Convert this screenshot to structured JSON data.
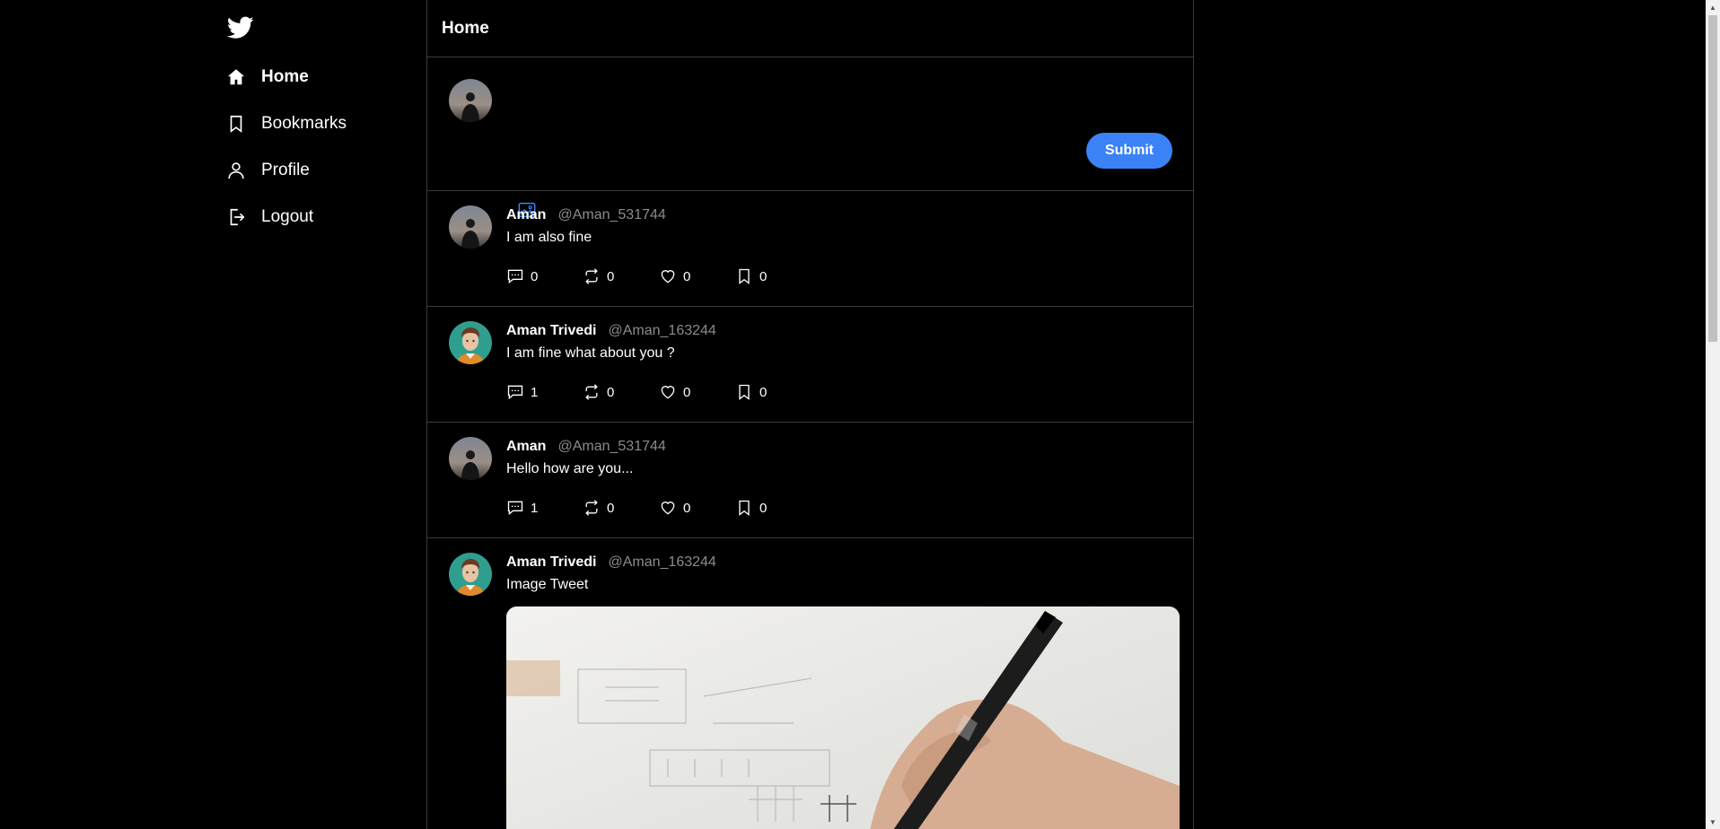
{
  "sidebar": {
    "logo": "bird-icon",
    "items": [
      {
        "label": "Home",
        "icon": "home-icon",
        "active": true
      },
      {
        "label": "Bookmarks",
        "icon": "bookmark-icon",
        "active": false
      },
      {
        "label": "Profile",
        "icon": "user-icon",
        "active": false
      },
      {
        "label": "Logout",
        "icon": "logout-icon",
        "active": false
      }
    ]
  },
  "header": {
    "title": "Home"
  },
  "composer": {
    "placeholder": "",
    "media_icon": "image-icon",
    "submit_label": "Submit"
  },
  "tweets": [
    {
      "name": "Aman",
      "handle": "@Aman_531744",
      "text": "I am also fine",
      "avatar": "silhouette",
      "comments": "0",
      "retweets": "0",
      "likes": "0",
      "bookmarks": "0"
    },
    {
      "name": "Aman Trivedi",
      "handle": "@Aman_163244",
      "text": "I am fine what about you ?",
      "avatar": "cartoon",
      "comments": "1",
      "retweets": "0",
      "likes": "0",
      "bookmarks": "0"
    },
    {
      "name": "Aman",
      "handle": "@Aman_531744",
      "text": "Hello how are you...",
      "avatar": "silhouette",
      "comments": "1",
      "retweets": "0",
      "likes": "0",
      "bookmarks": "0"
    },
    {
      "name": "Aman Trivedi",
      "handle": "@Aman_163244",
      "text": "Image Tweet",
      "avatar": "cartoon",
      "has_image": true
    }
  ],
  "colors": {
    "accent": "#3b82f6",
    "background": "#000000",
    "border": "#3b3b3b",
    "muted": "#8b8b8b"
  }
}
